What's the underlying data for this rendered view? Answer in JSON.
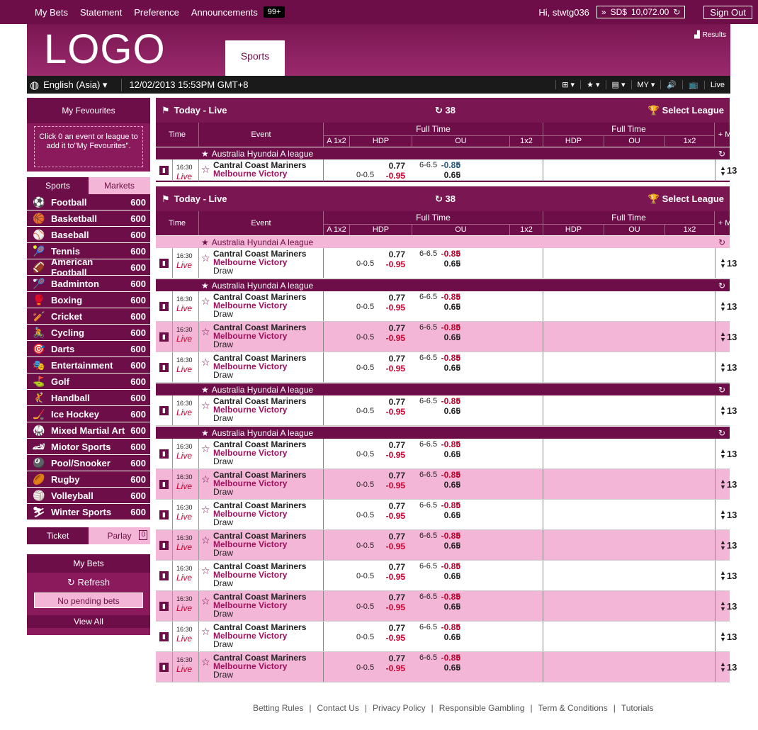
{
  "topbar": {
    "links": [
      "My Bets",
      "Statement",
      "Preference",
      "Announcements"
    ],
    "badge": "99+",
    "greeting": "Hi, stwtg036",
    "currency": "SD$",
    "balance": "10,072.00",
    "signout": "Sign Out"
  },
  "header": {
    "logo": "LOGO",
    "tab": "Sports",
    "results": "Results"
  },
  "bar": {
    "lang": "English (Asia)",
    "datetime": "12/02/2013 15:53PM GMT+8",
    "odds": "MY",
    "live": "Live"
  },
  "left": {
    "fav_title": "My Fevourites",
    "fav_text": "Click 0 an event or league to add it to\"My Fevourites\".",
    "tab_sports": "Sports",
    "tab_markets": "Markets",
    "sports": [
      {
        "n": "Football",
        "c": "600",
        "i": "⚽"
      },
      {
        "n": "Basketball",
        "c": "600",
        "i": "🏀"
      },
      {
        "n": "Baseball",
        "c": "600",
        "i": "⚾"
      },
      {
        "n": "Tennis",
        "c": "600",
        "i": "🎾"
      },
      {
        "n": "American Football",
        "c": "600",
        "i": "🏈"
      },
      {
        "n": "Badminton",
        "c": "600",
        "i": "🏸"
      },
      {
        "n": "Boxing",
        "c": "600",
        "i": "🥊"
      },
      {
        "n": "Cricket",
        "c": "600",
        "i": "🏏"
      },
      {
        "n": "Cycling",
        "c": "600",
        "i": "🚴"
      },
      {
        "n": "Darts",
        "c": "600",
        "i": "🎯"
      },
      {
        "n": "Entertainment",
        "c": "600",
        "i": "🎭"
      },
      {
        "n": "Golf",
        "c": "600",
        "i": "⛳"
      },
      {
        "n": "Handball",
        "c": "600",
        "i": "🤾"
      },
      {
        "n": "Ice Hockey",
        "c": "600",
        "i": "🏒"
      },
      {
        "n": "Mixed Martial Art",
        "c": "600",
        "i": "🥋"
      },
      {
        "n": "Miotor Sports",
        "c": "600",
        "i": "🏎"
      },
      {
        "n": "Pool/Snooker",
        "c": "600",
        "i": "🎱"
      },
      {
        "n": "Rugby",
        "c": "600",
        "i": "🏉"
      },
      {
        "n": "Volleyball",
        "c": "600",
        "i": "🏐"
      },
      {
        "n": "Winter Sports",
        "c": "600",
        "i": "⛷"
      }
    ],
    "ticket": "Ticket",
    "parlay": "Parlay",
    "parlay_count": "0",
    "mybets": "My Bets",
    "refresh": "Refresh",
    "nopending": "No pending bets",
    "viewall": "View All"
  },
  "main": {
    "title": "Today - Live",
    "count": "38",
    "select": "Select League",
    "h_time": "Time",
    "h_event": "Event",
    "h_ft": "Full Time",
    "h_a1x2": "A 1x2",
    "h_hdp": "HDP",
    "h_ou": "OU",
    "h_1x2": "1x2",
    "h_more": "+ More",
    "league": "Australia Hyundai A league",
    "match": {
      "time": "16:30",
      "live": "Live",
      "home": "Cantral Coast Mariners",
      "away": "Melbourne Victory",
      "draw": "Draw",
      "hdp_line": "0-0.5",
      "hdp_h": "0.77",
      "hdp_a": "-0.95",
      "ou_line": "6-6.5",
      "o": "o",
      "u": "u",
      "ou_o": "-0.85",
      "ou_u": "0.65",
      "more": "13"
    }
  },
  "footer": [
    "Betting Rules",
    "Contact Us",
    "Privacy Policy",
    "Responsible Gambling",
    "Term & Conditions",
    "Tutorials"
  ]
}
